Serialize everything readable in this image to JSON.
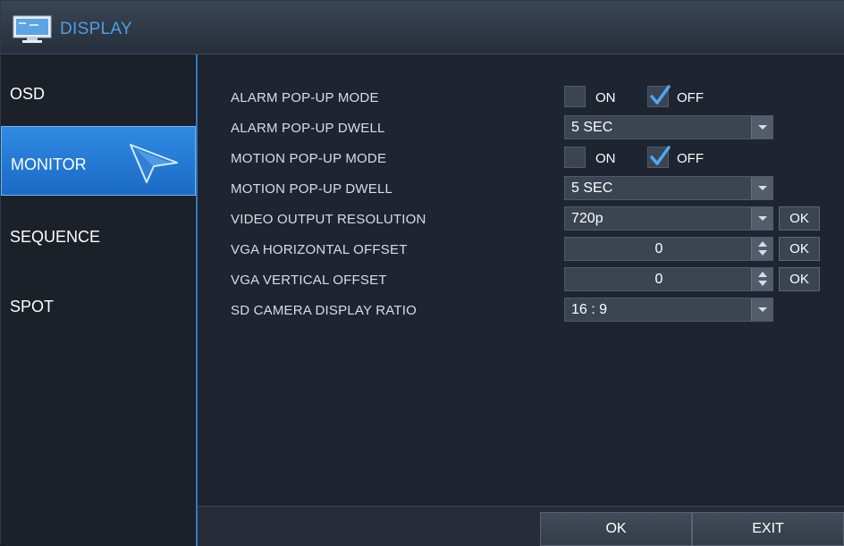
{
  "window": {
    "title": "DISPLAY",
    "title_icon": "monitor-icon",
    "title_color": "#4e9ee5",
    "accent_color": "#2f8ae2"
  },
  "sidebar": {
    "items": [
      {
        "label": "OSD",
        "active": false
      },
      {
        "label": "MONITOR",
        "active": true
      },
      {
        "label": "SEQUENCE",
        "active": false
      },
      {
        "label": "SPOT",
        "active": false
      }
    ]
  },
  "settings": {
    "alarm_popup_mode": {
      "label": "ALARM POP-UP MODE",
      "on_label": "ON",
      "off_label": "OFF",
      "on_checked": false,
      "off_checked": true
    },
    "alarm_popup_dwell": {
      "label": "ALARM POP-UP DWELL",
      "value": "5 SEC"
    },
    "motion_popup_mode": {
      "label": "MOTION POP-UP MODE",
      "on_label": "ON",
      "off_label": "OFF",
      "on_checked": false,
      "off_checked": true
    },
    "motion_popup_dwell": {
      "label": "MOTION POP-UP DWELL",
      "value": "5 SEC"
    },
    "video_output_resolution": {
      "label": "VIDEO OUTPUT RESOLUTION",
      "value": "720p",
      "ok_label": "OK"
    },
    "vga_horizontal_offset": {
      "label": "VGA HORIZONTAL OFFSET",
      "value": "0",
      "ok_label": "OK"
    },
    "vga_vertical_offset": {
      "label": "VGA VERTICAL OFFSET",
      "value": "0",
      "ok_label": "OK"
    },
    "sd_camera_display_ratio": {
      "label": "SD CAMERA DISPLAY RATIO",
      "value": "16 : 9"
    }
  },
  "footer": {
    "ok_label": "OK",
    "exit_label": "EXIT"
  }
}
